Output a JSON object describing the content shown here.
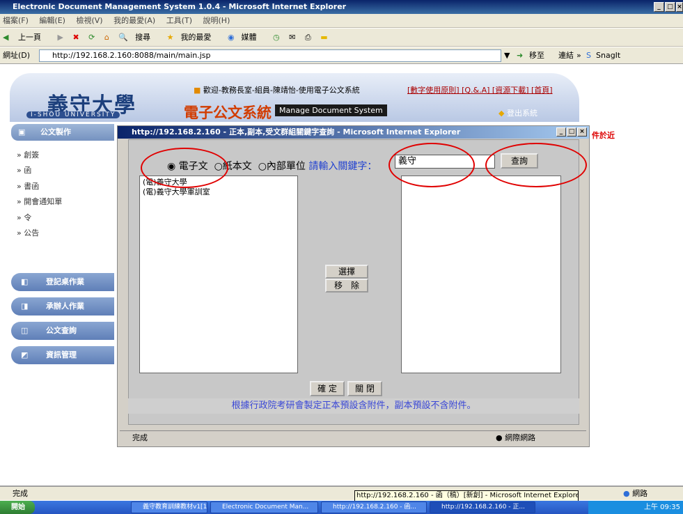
{
  "ie": {
    "title": "Electronic Document Management System 1.0.4 - Microsoft Internet Explorer",
    "menu": [
      "檔案(F)",
      "編輯(E)",
      "檢視(V)",
      "我的最愛(A)",
      "工具(T)",
      "說明(H)"
    ],
    "toolbar": {
      "back": "上一頁",
      "search": "搜尋",
      "favorites": "我的最愛",
      "media": "媒體"
    },
    "address_label": "網址(D)",
    "address_value": "http://192.168.2.160:8088/main/main.jsp",
    "go_label": "移至",
    "links_label": "連結",
    "snagit": "SnagIt",
    "status_left": "完成",
    "status_zone": "網路"
  },
  "header": {
    "logo_zh": "義守大學",
    "logo_en": "I-SHOU UNIVERSITY",
    "system_zh": "電子公文系統",
    "system_en": "Manage Document System",
    "welcome": "歡迎-教務長室-組員-陳靖怡-使用電子公文系統",
    "links": "[數字使用原則] [Q.&.A] [資源下載] [首頁]",
    "logout": "登出系統"
  },
  "sidebar": {
    "section": "公文製作",
    "items": [
      "創簽",
      "函",
      "書函",
      "開會通知單",
      "令",
      "公告"
    ],
    "buttons": [
      "登記桌作業",
      "承辦人作業",
      "公文查詢",
      "資訊管理"
    ]
  },
  "popup": {
    "title": "http://192.168.2.160 - 正本,副本,受文群組關鍵字查詢 - Microsoft Internet Explorer",
    "radios": [
      "電子文",
      "紙本文",
      "內部單位"
    ],
    "keyword_label": "請輸入關鍵字：",
    "keyword_value": "義守",
    "query_button": "查詢",
    "left_list": [
      "(電)義守大學",
      "(電)義守大學軍訓室"
    ],
    "select_button": "選擇",
    "remove_button": "移　除",
    "confirm_button": "確 定",
    "close_button": "關 閉",
    "note": "根據行政院考研會製定正本預設含附件，副本預設不含附件。",
    "status_left": "完成",
    "status_zone": "網際網路"
  },
  "background_right": "件於近",
  "tooltip": "http://192.168.2.160 - 函（稿）[新創] - Microsoft Internet Explorer",
  "taskbar": {
    "start": "開始",
    "tasks": [
      "義守教育訓練教材v1[1]...",
      "Electronic Document Man...",
      "http://192.168.2.160 - 函...",
      "http://192.168.2.160 - 正..."
    ],
    "clock": "上午 09:35"
  }
}
